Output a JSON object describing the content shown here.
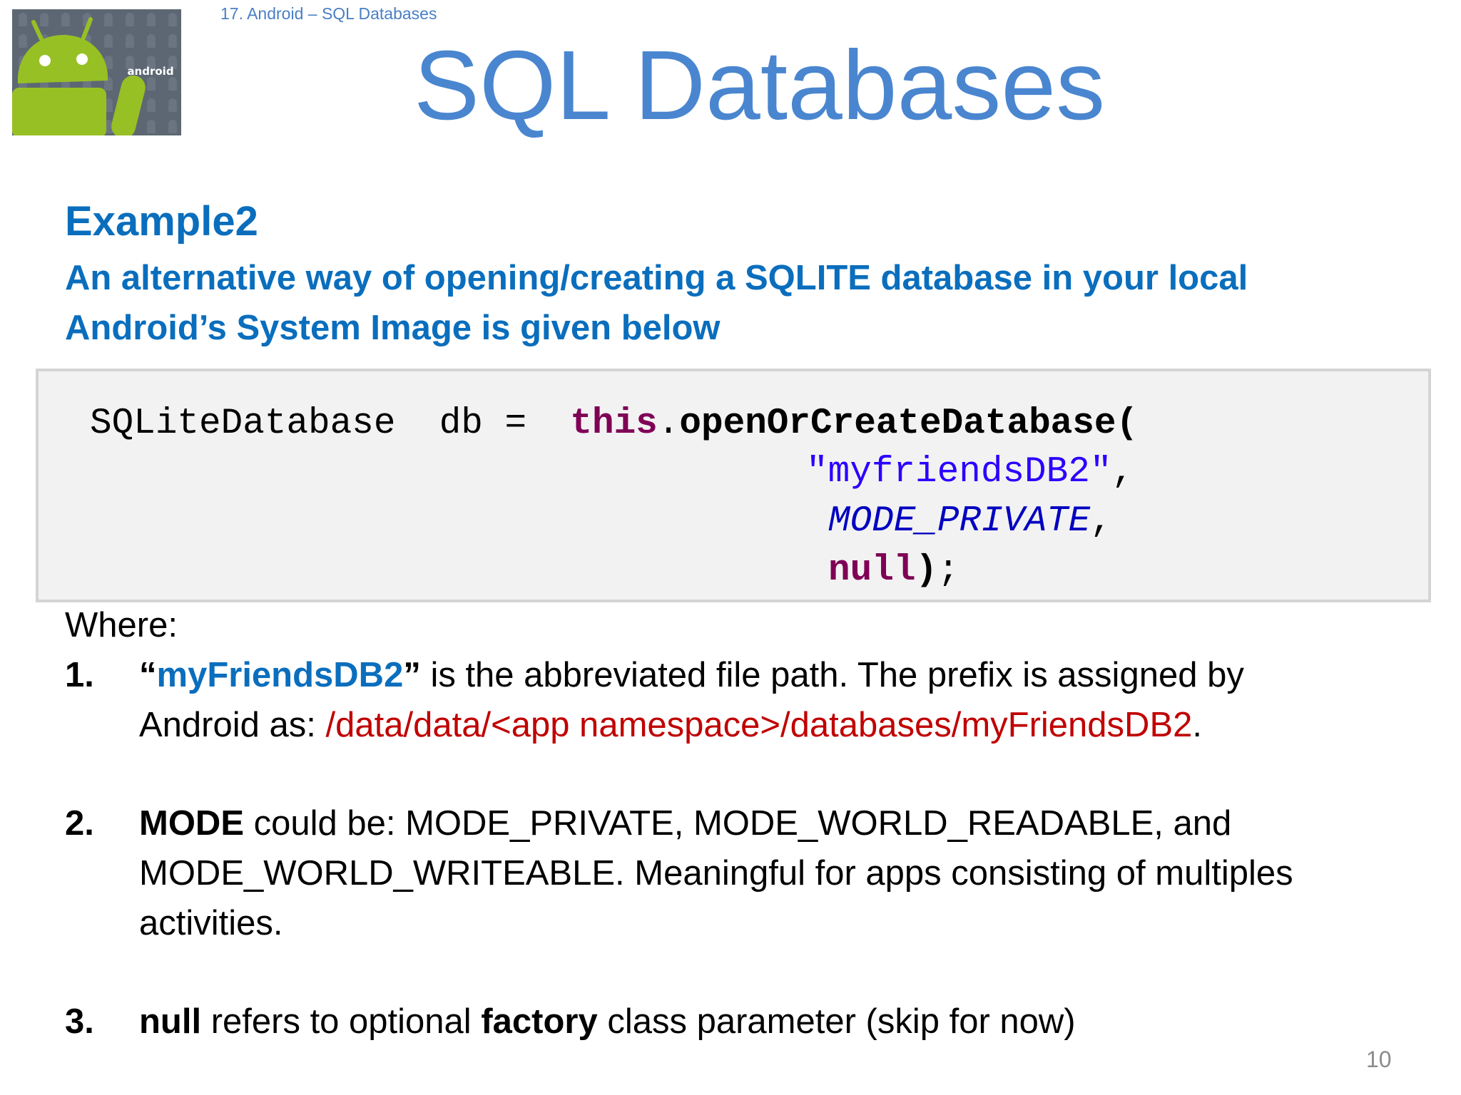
{
  "header": {
    "breadcrumb": "17. Android – SQL Databases",
    "title": "SQL Databases",
    "logo_text": "android"
  },
  "content": {
    "example_heading": "Example2",
    "subtitle_lines": [
      "An alternative way of opening/creating a SQLITE database in your local",
      "Android’s System Image is given below"
    ],
    "code": {
      "type_name": "SQLiteDatabase",
      "var_name": "db",
      "equals": "=",
      "this_kw": "this",
      "dot": ".",
      "method": "openOrCreateDatabase",
      "open_paren": "(",
      "db_name": "\"myfriendsDB2\"",
      "comma": ",",
      "mode_const": "MODE_PRIVATE",
      "null_kw": "null",
      "close_paren": ")",
      "semicolon": ";"
    },
    "where_label": "Where:",
    "items": [
      {
        "number": "1.",
        "open_quote": "“",
        "highlight": "myFriendsDB2",
        "close_quote": "”",
        "text_after": " is the abbreviated file path. The prefix is assigned by",
        "line2_prefix": "Android as: ",
        "path": "/data/data/<app namespace>/databases/myFriendsDB2",
        "line2_suffix": "."
      },
      {
        "number": "2.",
        "bold_lead": "MODE",
        "line1_rest": " could be: MODE_PRIVATE, MODE_WORLD_READABLE, and",
        "line2": "MODE_WORLD_WRITEABLE. Meaningful for apps consisting of multiples",
        "line3": "activities."
      },
      {
        "number": "3.",
        "bold_lead": "null",
        "mid": " refers to optional ",
        "bold_word": "factory",
        "tail": " class parameter (skip for now)"
      }
    ]
  },
  "footer": {
    "page_number": "10"
  },
  "colors": {
    "title": "#4a86cf",
    "heading": "#0a6ebd",
    "path_red": "#c00000",
    "keyword": "#7f0055",
    "string": "#2a00ff",
    "constant": "#0000c0",
    "android_green": "#97c024"
  }
}
